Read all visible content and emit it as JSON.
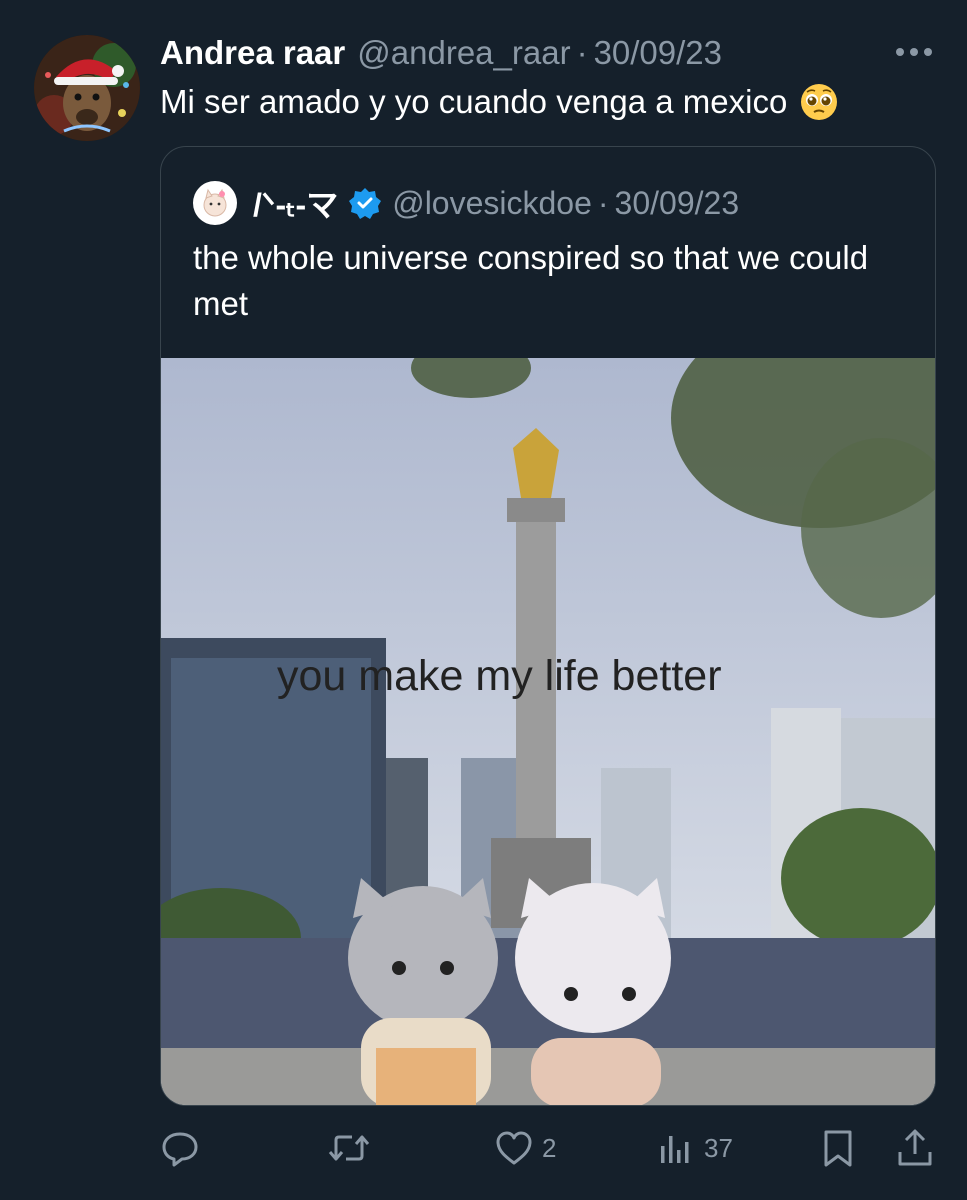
{
  "tweet": {
    "author_name": "Andrea raar",
    "author_handle": "@andrea_raar",
    "separator": "·",
    "date": "30/09/23",
    "text": "Mi ser amado y yo cuando venga a mexico",
    "emoji": "pleading-face-emoji"
  },
  "quoted": {
    "author_name": "/ᐠ-ₜ-マ",
    "verified": true,
    "author_handle": "@lovesickdoe",
    "separator": "·",
    "date": "30/09/23",
    "text": "the whole universe conspired so that we could met",
    "media_caption": "you make my life better"
  },
  "actions": {
    "reply_count": "",
    "retweet_count": "",
    "like_count": "2",
    "views_count": "37"
  },
  "colors": {
    "background": "#15202b",
    "secondary_text": "#8b98a5",
    "verified_blue": "#1d9bf0",
    "border": "#38444d"
  }
}
